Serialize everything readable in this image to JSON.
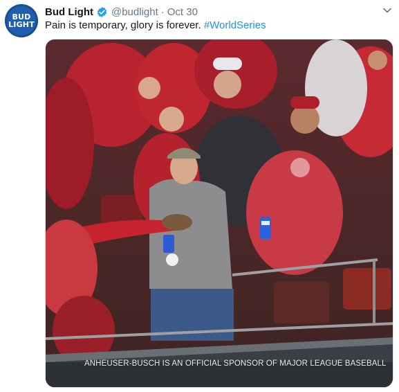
{
  "tweet": {
    "avatar_line1": "BUD",
    "avatar_line2": "LIGHT",
    "name": "Bud Light",
    "handle": "@budlight",
    "separator": "·",
    "date": "Oct 30",
    "text": "Pain is temporary, glory is forever.",
    "hashtag": "#WorldSeries",
    "media_caption": "ANHEUSER-BUSCH IS AN OFFICIAL SPONSOR OF MAJOR LEAGUE BASEBALL"
  },
  "icons": {
    "verified": "verified-badge-icon",
    "more": "chevron-down-icon"
  },
  "colors": {
    "brand_blue": "#1f5fae",
    "hashtag": "#1b95e0",
    "muted": "#657786",
    "verified": "#1da1f2"
  }
}
